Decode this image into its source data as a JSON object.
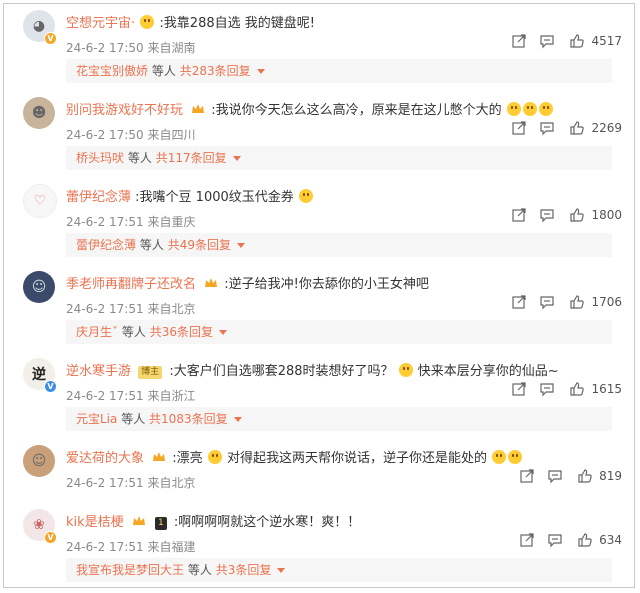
{
  "comments": [
    {
      "username": "空想元宇宙·",
      "text": ":我靠288自选 我的键盘呢!",
      "date": "24-6-2 17:50",
      "location": "来自湖南",
      "likes": "4517",
      "reply_user": "花宝宝别傲娇",
      "reply_etc": "等人",
      "reply_count": "共283条回复"
    },
    {
      "username": "别问我游戏好不好玩",
      "text": ":我说你今天怎么这么高冷，原来是在这儿憋个大的",
      "date": "24-6-2 17:50",
      "location": "来自四川",
      "likes": "2269",
      "reply_user": "桥头玛吠",
      "reply_etc": "等人",
      "reply_count": "共117条回复"
    },
    {
      "username": "蕾伊纪念薄",
      "text": ":我嘴个豆 1000纹玉代金券",
      "date": "24-6-2 17:51",
      "location": "来自重庆",
      "likes": "1800",
      "reply_user": "蕾伊纪念薄",
      "reply_etc": "等人",
      "reply_count": "共49条回复"
    },
    {
      "username": "季老师再翻牌子还改名",
      "text": ":逆子给我冲!你去舔你的小王女神吧",
      "date": "24-6-2 17:51",
      "location": "来自北京",
      "likes": "1706",
      "reply_user": "庆月生ˇ",
      "reply_etc": "等人",
      "reply_count": "共36条回复"
    },
    {
      "username": "逆水寒手游",
      "tag": "博主",
      "text": ":大客户们自选哪套288时装想好了吗？",
      "text2": "快来本层分享你的仙品~",
      "date": "24-6-2 17:51",
      "location": "来自浙江",
      "likes": "1615",
      "reply_user": "元宝Lia",
      "reply_etc": "等人",
      "reply_count": "共1083条回复"
    },
    {
      "username": "爱达荷的大象",
      "text": ":漂亮",
      "text2": "对得起我这两天帮你说话，逆子你还是能处的",
      "date": "24-6-2 17:51",
      "location": "来自北京",
      "likes": "819"
    },
    {
      "username": "kik是桔梗",
      "tag": "1",
      "text": ":啊啊啊啊就这个逆水寒！爽！！",
      "date": "24-6-2 17:51",
      "location": "来自福建",
      "likes": "634",
      "reply_user": "我宣布我是梦回大王",
      "reply_etc": "等人",
      "reply_count": "共3条回复"
    }
  ],
  "colors": {
    "username": "#eb7350",
    "meta": "#8a8a8a",
    "reply_bg": "#f6f6f6"
  },
  "icons": {
    "share": "share-icon",
    "comment": "comment-icon",
    "like": "thumbs-up-icon"
  }
}
